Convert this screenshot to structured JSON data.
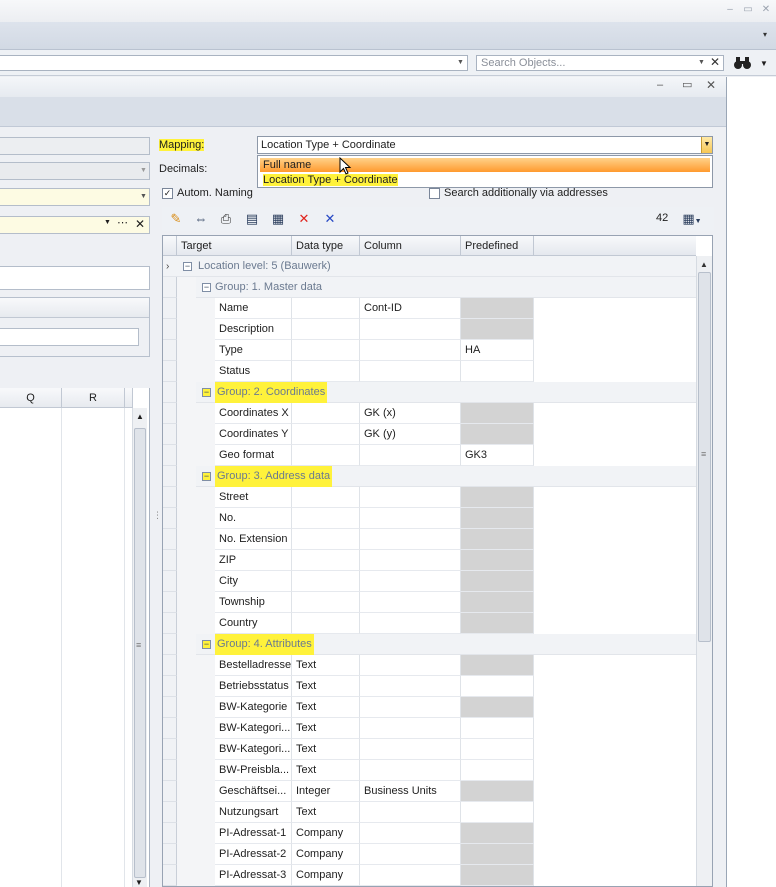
{
  "search": {
    "placeholder": "Search Objects..."
  },
  "left_grid": {
    "columns": [
      "Q",
      "R"
    ]
  },
  "mapping": {
    "label": "Mapping:",
    "value": "Location Type + Coordinate",
    "options": [
      "Full name",
      "Location Type + Coordinate"
    ]
  },
  "decimals_label": "Decimals:",
  "autom_naming_label": "Autom. Naming",
  "search_addresses_label": "Search additionally via addresses",
  "record_count": "42",
  "grid": {
    "columns": [
      "Target",
      "Data type",
      "Column",
      "Predefined"
    ],
    "location_level": "Location level: 5 (Bauwerk)",
    "groups": [
      {
        "title": "Group: 1. Master data",
        "rows": [
          {
            "target": "Name",
            "type": "",
            "column": "Cont-ID",
            "predefined": "",
            "gray": true
          },
          {
            "target": "Description",
            "type": "",
            "column": "",
            "predefined": "",
            "gray": true
          },
          {
            "target": "Type",
            "type": "",
            "column": "",
            "predefined": "HA",
            "gray": false
          },
          {
            "target": "Status",
            "type": "",
            "column": "",
            "predefined": "",
            "gray": false
          }
        ]
      },
      {
        "title": "Group: 2. Coordinates",
        "rows": [
          {
            "target": "Coordinates X",
            "type": "",
            "column": "GK (x)",
            "predefined": "",
            "gray": true
          },
          {
            "target": "Coordinates Y",
            "type": "",
            "column": "GK (y)",
            "predefined": "",
            "gray": true
          },
          {
            "target": "Geo format",
            "type": "",
            "column": "",
            "predefined": "GK3",
            "gray": false
          }
        ]
      },
      {
        "title": "Group: 3. Address data",
        "rows": [
          {
            "target": "Street",
            "type": "",
            "column": "",
            "predefined": "",
            "gray": true
          },
          {
            "target": "No.",
            "type": "",
            "column": "",
            "predefined": "",
            "gray": true
          },
          {
            "target": "No. Extension",
            "type": "",
            "column": "",
            "predefined": "",
            "gray": true
          },
          {
            "target": "ZIP",
            "type": "",
            "column": "",
            "predefined": "",
            "gray": true
          },
          {
            "target": "City",
            "type": "",
            "column": "",
            "predefined": "",
            "gray": true
          },
          {
            "target": "Township",
            "type": "",
            "column": "",
            "predefined": "",
            "gray": true
          },
          {
            "target": "Country",
            "type": "",
            "column": "",
            "predefined": "",
            "gray": true
          }
        ]
      },
      {
        "title": "Group: 4. Attributes",
        "rows": [
          {
            "target": "Bestelladresse",
            "type": "Text",
            "column": "",
            "predefined": "",
            "gray": true
          },
          {
            "target": "Betriebsstatus",
            "type": "Text",
            "column": "",
            "predefined": "",
            "gray": false
          },
          {
            "target": "BW-Kategorie",
            "type": "Text",
            "column": "",
            "predefined": "",
            "gray": true
          },
          {
            "target": "BW-Kategori...",
            "type": "Text",
            "column": "",
            "predefined": "",
            "gray": false
          },
          {
            "target": "BW-Kategori...",
            "type": "Text",
            "column": "",
            "predefined": "",
            "gray": false
          },
          {
            "target": "BW-Preisbla...",
            "type": "Text",
            "column": "",
            "predefined": "",
            "gray": false
          },
          {
            "target": "Geschäftsei...",
            "type": "Integer",
            "column": "Business Units",
            "predefined": "",
            "gray": true
          },
          {
            "target": "Nutzungsart",
            "type": "Text",
            "column": "",
            "predefined": "",
            "gray": false
          },
          {
            "target": "PI-Adressat-1",
            "type": "Company",
            "column": "",
            "predefined": "",
            "gray": true
          },
          {
            "target": "PI-Adressat-2",
            "type": "Company",
            "column": "",
            "predefined": "",
            "gray": true
          },
          {
            "target": "PI-Adressat-3",
            "type": "Company",
            "column": "",
            "predefined": "",
            "gray": true
          }
        ]
      }
    ]
  },
  "colors": {
    "highlight": "#fff23b",
    "selected_option": "#ff9a2e",
    "gray_cell": "#d3d3d3"
  }
}
